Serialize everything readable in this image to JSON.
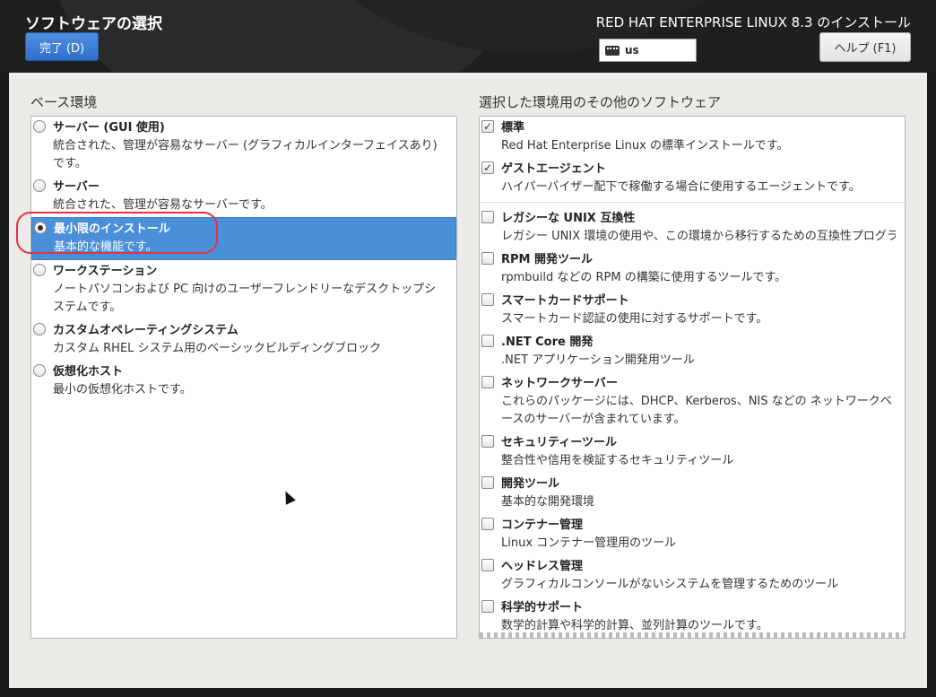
{
  "header": {
    "page_title": "ソフトウェアの選択",
    "done_button": "完了 (D)",
    "product_title": "RED HAT ENTERPRISE LINUX 8.3 のインストール",
    "keyboard_layout": "us",
    "help_button": "ヘルプ (F1)"
  },
  "base_env": {
    "label": "ベース環境",
    "items": [
      {
        "title": "サーバー (GUI 使用)",
        "desc": "統合された、管理が容易なサーバー (グラフィカルインターフェイスあり) です。",
        "selected": false
      },
      {
        "title": "サーバー",
        "desc": "統合された、管理が容易なサーバーです。",
        "selected": false
      },
      {
        "title": "最小限のインストール",
        "desc": "基本的な機能です。",
        "selected": true
      },
      {
        "title": "ワークステーション",
        "desc": "ノートパソコンおよび PC 向けのユーザーフレンドリーなデスクトップシステムです。",
        "selected": false
      },
      {
        "title": "カスタムオペレーティングシステム",
        "desc": "カスタム RHEL システム用のベーシックビルディングブロック",
        "selected": false
      },
      {
        "title": "仮想化ホスト",
        "desc": "最小の仮想化ホストです。",
        "selected": false
      }
    ]
  },
  "addons": {
    "label": "選択した環境用のその他のソフトウェア",
    "checked_items": [
      {
        "title": "標準",
        "desc": "Red Hat Enterprise Linux の標準インストールです。"
      },
      {
        "title": "ゲストエージェント",
        "desc": "ハイパーバイザー配下で稼働する場合に使用するエージェントです。"
      }
    ],
    "items": [
      {
        "title": "レガシーな UNIX 互換性",
        "desc": "レガシー UNIX 環境の使用や、この環境から移行するための互換性プログラム"
      },
      {
        "title": "RPM 開発ツール",
        "desc": "rpmbuild などの RPM の構築に使用するツールです。"
      },
      {
        "title": "スマートカードサポート",
        "desc": "スマートカード認証の使用に対するサポートです。"
      },
      {
        "title": ".NET Core 開発",
        "desc": ".NET アプリケーション開発用ツール"
      },
      {
        "title": "ネットワークサーバー",
        "desc": "これらのパッケージには、DHCP、Kerberos、NIS などの ネットワークベースのサーバーが含まれています。"
      },
      {
        "title": "セキュリティーツール",
        "desc": "整合性や信用を検証するセキュリティツール"
      },
      {
        "title": "開発ツール",
        "desc": "基本的な開発環境"
      },
      {
        "title": "コンテナー管理",
        "desc": "Linux コンテナー管理用のツール"
      },
      {
        "title": "ヘッドレス管理",
        "desc": "グラフィカルコンソールがないシステムを管理するためのツール"
      },
      {
        "title": "科学的サポート",
        "desc": "数学的計算や科学的計算、並列計算のツールです。"
      }
    ]
  },
  "colors": {
    "selected_bg": "#4a90d9",
    "primary_button": "#2e6fca",
    "annotation": "#e0324a"
  }
}
